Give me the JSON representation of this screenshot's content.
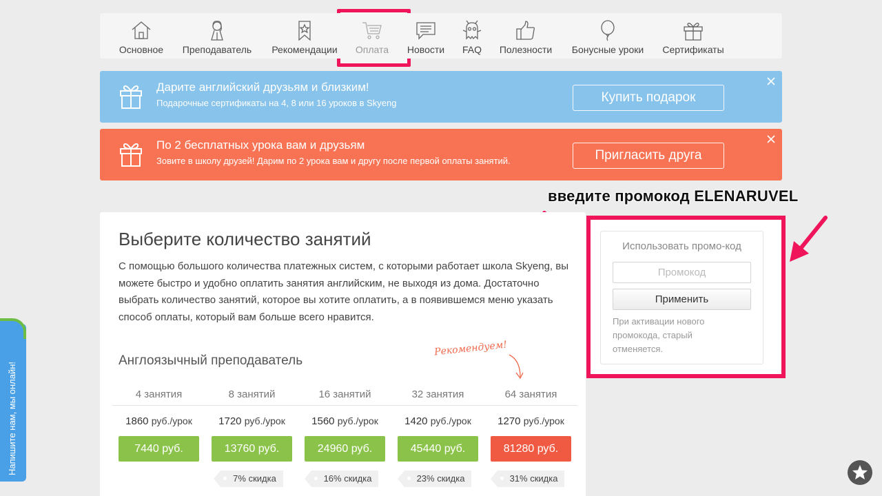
{
  "nav": {
    "items": [
      {
        "label": "Основное",
        "icon": "home-icon",
        "active": false
      },
      {
        "label": "Преподаватель",
        "icon": "teacher-icon",
        "active": false
      },
      {
        "label": "Рекомендации",
        "icon": "bookmark-star-icon",
        "active": false
      },
      {
        "label": "Оплата",
        "icon": "cart-icon",
        "active": true
      },
      {
        "label": "Новости",
        "icon": "news-chat-icon",
        "active": false
      },
      {
        "label": "FAQ",
        "icon": "alien-icon",
        "active": false
      },
      {
        "label": "Полезности",
        "icon": "thumbs-up-icon",
        "active": false
      },
      {
        "label": "Бонусные уроки",
        "icon": "balloon-icon",
        "active": false
      },
      {
        "label": "Сертификаты",
        "icon": "gift-icon",
        "active": false
      }
    ]
  },
  "banners": {
    "gift": {
      "title": "Дарите английский друзьям и близким!",
      "subtitle": "Подарочные сертификаты на 4, 8 или 16 уроков в Skyeng",
      "button": "Купить подарок",
      "color": "#87c3ea"
    },
    "invite": {
      "title": "По 2 бесплатных урока вам и друзьям",
      "subtitle": "Зовите в школу друзей! Дарим по 2 урока вам и другу после первой оплаты занятий.",
      "button": "Пригласить друга",
      "color": "#f87354"
    }
  },
  "annotation": {
    "callout": "введите промокод ELENARUVEL",
    "highlight_color": "#f0145a"
  },
  "main": {
    "title": "Выберите количество занятий",
    "description": "С помощью большого количества платежных систем, с которыми работает школа Skyeng, вы можете быстро и удобно оплатить занятия английским, не выходя из дома. Достаточно выбрать количество занятий, которое вы хотите оплатить, а в появившемся меню указать способ оплаты, который вам больше всего нравится.",
    "section_title": "Англоязычный преподаватель",
    "recommend_label": "Рекомендуем!",
    "packages": [
      {
        "count": "4 занятия",
        "per_lesson": "1860",
        "unit": "руб./урок",
        "total": "7440 руб.",
        "discount": null,
        "recommended": false
      },
      {
        "count": "8 занятий",
        "per_lesson": "1720",
        "unit": "руб./урок",
        "total": "13760 руб.",
        "discount": "7% скидка",
        "recommended": false
      },
      {
        "count": "16 занятий",
        "per_lesson": "1560",
        "unit": "руб./урок",
        "total": "24960 руб.",
        "discount": "16% скидка",
        "recommended": false
      },
      {
        "count": "32 занятия",
        "per_lesson": "1420",
        "unit": "руб./урок",
        "total": "45440 руб.",
        "discount": "23% скидка",
        "recommended": false
      },
      {
        "count": "64 занятия",
        "per_lesson": "1270",
        "unit": "руб./урок",
        "total": "81280 руб.",
        "discount": "31% скидка",
        "recommended": true
      }
    ]
  },
  "promo": {
    "title": "Использовать промо-код",
    "placeholder": "Промокод",
    "value": "",
    "button": "Применить",
    "note": "При активации нового промокода, старый отменяется."
  },
  "chat": {
    "label": "Напишите нам, мы онлайн!"
  },
  "favorite": {
    "icon": "star-icon"
  }
}
